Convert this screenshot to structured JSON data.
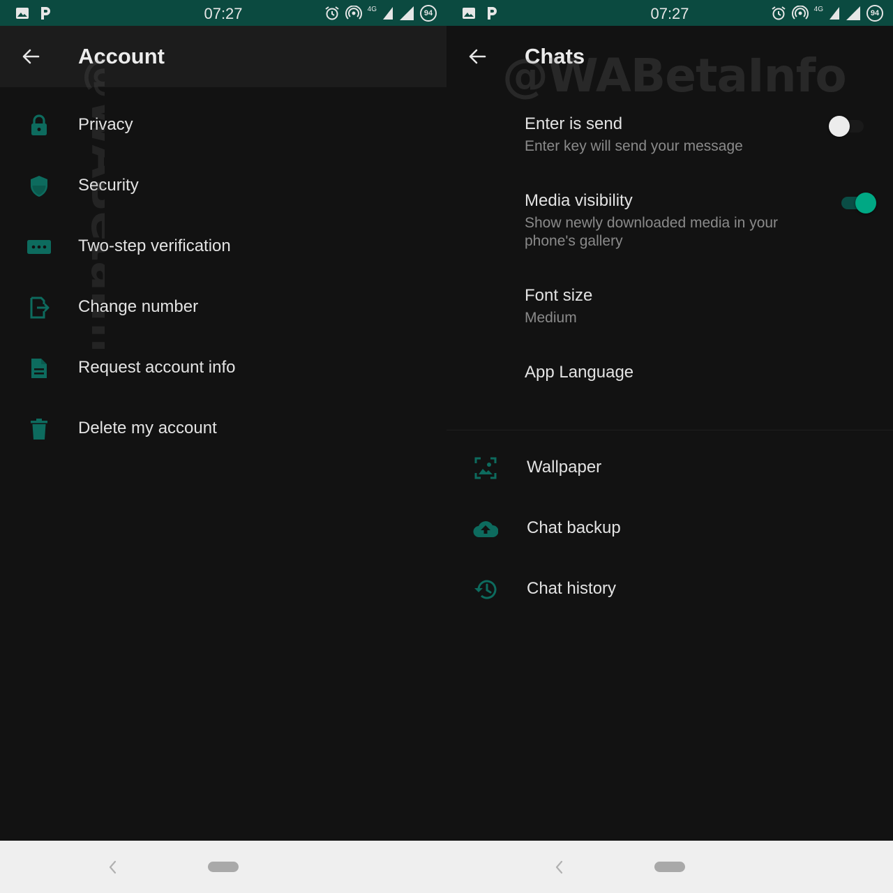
{
  "status_bar": {
    "time": "07:27",
    "network": "4G",
    "battery": "94"
  },
  "left": {
    "title": "Account",
    "items": [
      {
        "label": "Privacy",
        "icon": "lock-icon"
      },
      {
        "label": "Security",
        "icon": "shield-icon"
      },
      {
        "label": "Two-step verification",
        "icon": "dots-password-icon"
      },
      {
        "label": "Change number",
        "icon": "sim-swap-icon"
      },
      {
        "label": "Request account info",
        "icon": "document-icon"
      },
      {
        "label": "Delete my account",
        "icon": "trash-icon"
      }
    ],
    "watermark": "@WABetaInfo"
  },
  "right": {
    "title": "Chats",
    "watermark": "@WABetaInfo",
    "enter_is_send": {
      "title": "Enter is send",
      "subtitle": "Enter key will send your message",
      "enabled": false
    },
    "media_visibility": {
      "title": "Media visibility",
      "subtitle": "Show newly downloaded media in your phone's gallery",
      "enabled": true
    },
    "font_size": {
      "title": "Font size",
      "value": "Medium"
    },
    "app_language": {
      "title": "App Language"
    },
    "lower_items": [
      {
        "label": "Wallpaper",
        "icon": "wallpaper-icon"
      },
      {
        "label": "Chat backup",
        "icon": "cloud-upload-icon"
      },
      {
        "label": "Chat history",
        "icon": "history-icon"
      }
    ]
  },
  "colors": {
    "status_bar": "#0b4a40",
    "accent": "#00a884",
    "icon": "#0d6b5e",
    "background": "#121212",
    "app_bar": "#1c1c1c",
    "nav_bar": "#efefef"
  }
}
